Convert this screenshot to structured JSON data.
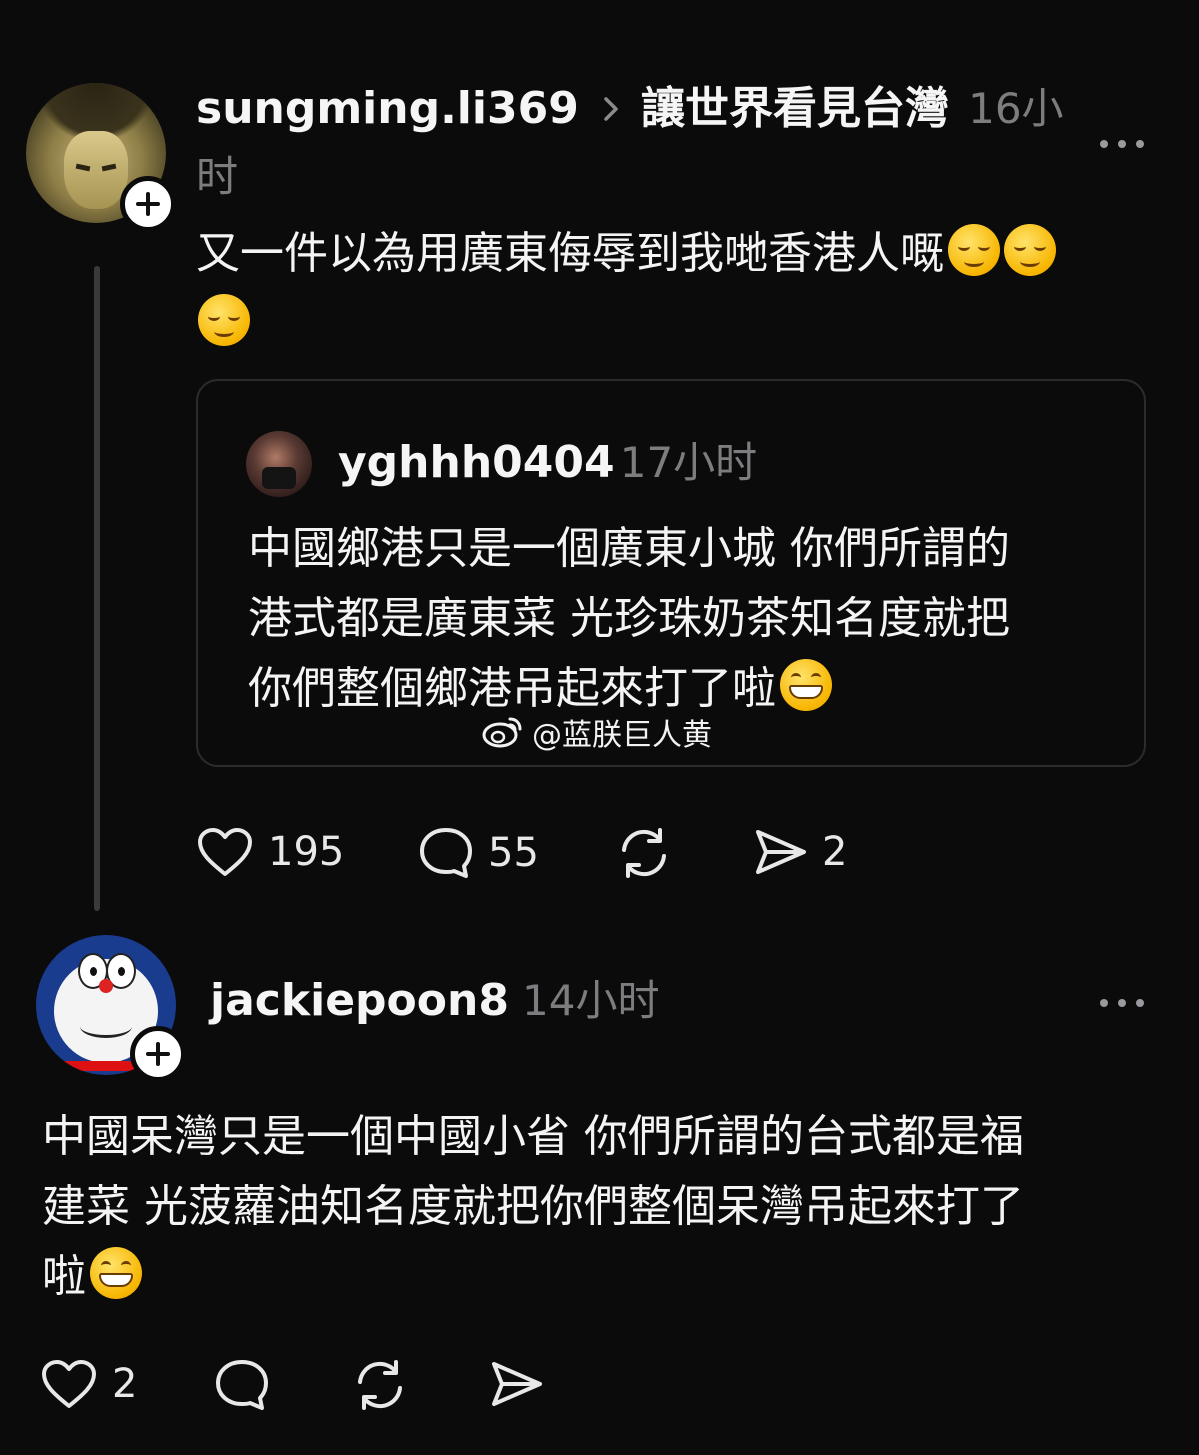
{
  "post": {
    "username": "sungming.li369",
    "topic": "讓世界看見台灣",
    "time_line1": "16小",
    "time_line2": "时",
    "text": "又一件以為用廣東侮辱到我哋香港人嘅",
    "quoted": {
      "username": "yghhh0404",
      "time": "17小时",
      "lines": [
        "中國鄉港只是一個廣東小城 你們所謂的",
        "港式都是廣東菜 光珍珠奶茶知名度就把",
        "你們整個鄉港吊起來打了啦"
      ],
      "watermark": "@蓝朕巨人黄"
    },
    "actions": {
      "likes": "195",
      "comments": "55",
      "shares": "2"
    },
    "emojis": [
      "relieved-face",
      "relieved-face",
      "relieved-face"
    ]
  },
  "reply": {
    "username": "jackiepoon8",
    "time": "14小时",
    "lines": [
      "中國呆灣只是一個中國小省 你們所謂的台式都是福",
      "建菜 光菠蘿油知名度就把你們整個呆灣吊起來打了",
      "啦"
    ],
    "actions": {
      "likes": "2"
    },
    "emojis": [
      "grinning-face"
    ]
  },
  "colors": {
    "background": "#0b0b0c",
    "text": "#f4f4f4",
    "muted": "#7d7d80"
  }
}
